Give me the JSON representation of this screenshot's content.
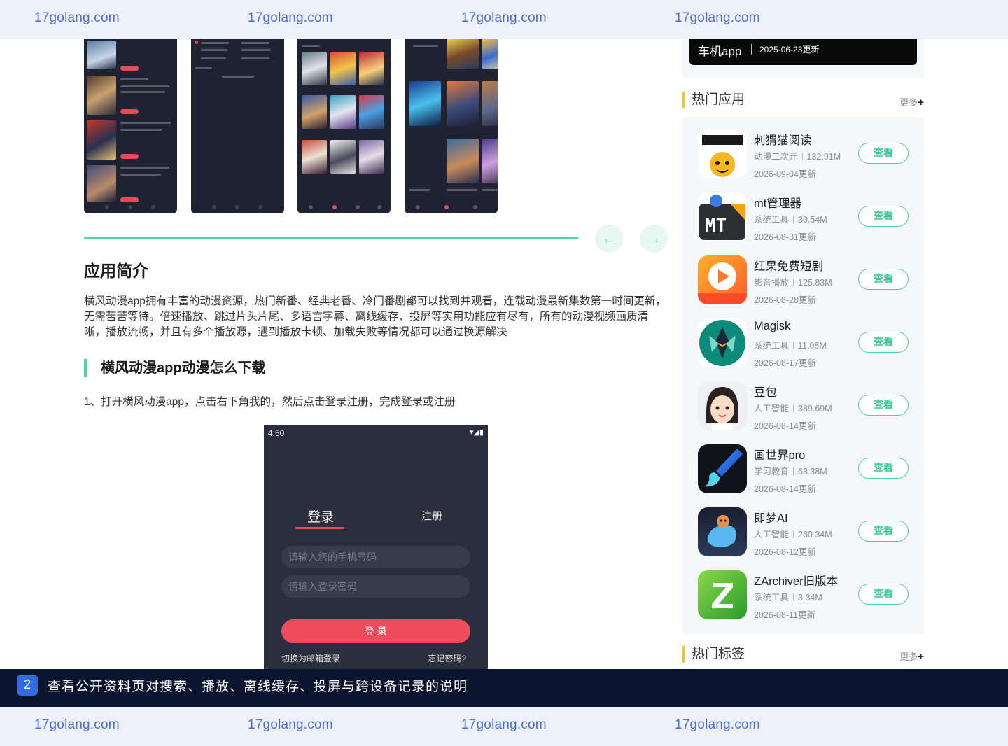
{
  "watermark": {
    "text": "17golang.com"
  },
  "gallery": {
    "prev_label": "←",
    "next_label": "→"
  },
  "article": {
    "section_title": "应用简介",
    "intro": "横风动漫app拥有丰富的动漫资源，热门新番、经典老番、冷门番剧都可以找到并观看，连载动漫最新集数第一时间更新，无需苦苦等待。倍速播放、跳过片头片尾、多语言字幕、离线缓存、投屏等实用功能应有尽有，所有的动漫视频画质清晰，播放流畅，并且有多个播放源，遇到播放卡顿、加载失败等情况都可以通过换源解决",
    "sub_title": "横风动漫app动漫怎么下载",
    "step1": "1、打开横风动漫app，点击右下角我的，然后点击登录注册，完成登录或注册"
  },
  "phone": {
    "time": "4:50",
    "status_icons": "▾◢▮",
    "tab_login": "登录",
    "tab_register": "注册",
    "phone_placeholder": "请输入您的手机号码",
    "password_placeholder": "请输入登录密码",
    "login_button": "登 录",
    "switch_email": "切换为邮箱登录",
    "forgot": "忘记密码?"
  },
  "sidebar": {
    "banner": {
      "title": "车机app",
      "date": "2025-06-23更新"
    },
    "hot_apps": {
      "heading": "热门应用",
      "more": "更多",
      "more_icon": "+",
      "view_label": "查看",
      "items": [
        {
          "name": "刺猬猫阅读",
          "category": "动漫二次元",
          "size": "132.91M",
          "date": "2026-09-04更新",
          "icon": "hedgehog-cat-icon"
        },
        {
          "name": "mt管理器",
          "category": "系统工具",
          "size": "30.54M",
          "date": "2026-08-31更新",
          "icon": "mt-manager-icon"
        },
        {
          "name": "红果免费短剧",
          "category": "影音播放",
          "size": "125.83M",
          "date": "2026-08-28更新",
          "icon": "red-fruit-play-icon"
        },
        {
          "name": "Magisk",
          "category": "系统工具",
          "size": "11.08M",
          "date": "2026-08-17更新",
          "icon": "magisk-icon"
        },
        {
          "name": "豆包",
          "category": "人工智能",
          "size": "389.69M",
          "date": "2026-08-14更新",
          "icon": "doubao-avatar-icon"
        },
        {
          "name": "画世界pro",
          "category": "学习教育",
          "size": "63.38M",
          "date": "2026-08-14更新",
          "icon": "paint-brush-icon"
        },
        {
          "name": "即梦AI",
          "category": "人工智能",
          "size": "260.34M",
          "date": "2026-08-12更新",
          "icon": "jimeng-ai-icon"
        },
        {
          "name": "ZArchiver旧版本",
          "category": "系统工具",
          "size": "3.34M",
          "date": "2026-08-11更新",
          "icon": "zarchiver-icon"
        }
      ]
    },
    "hot_tags": {
      "heading": "热门标签",
      "more": "更多",
      "more_icon": "+"
    }
  },
  "caption": {
    "number": "2",
    "text": "查看公开资料页对搜索、播放、离线缓存、投屏与跨设备记录的说明"
  },
  "colors": {
    "accent_green": "#4fd3a4",
    "accent_red": "#ef4b5d",
    "watermark_blue": "#4d6bd6",
    "caption_bg": "#0c1530",
    "tag_yellow": "#f5c518"
  }
}
